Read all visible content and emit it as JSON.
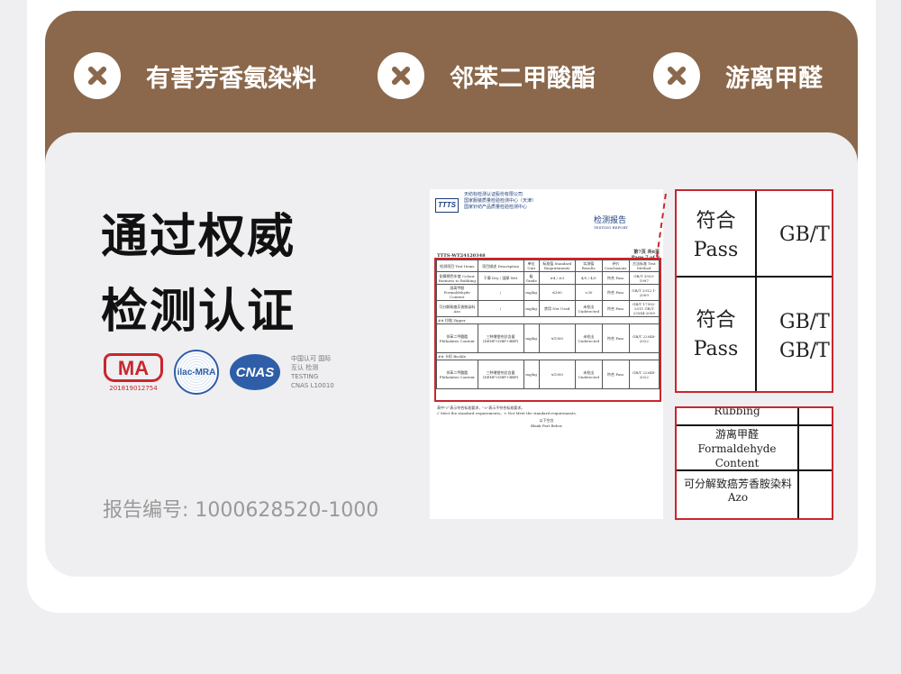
{
  "features": [
    {
      "icon": "x-circle-icon",
      "label": "有害芳香氨染料"
    },
    {
      "icon": "x-circle-icon",
      "label": "邻苯二甲酸酯"
    },
    {
      "icon": "x-circle-icon",
      "label": "游离甲醛"
    }
  ],
  "headline": {
    "line1": "通过权威",
    "line2": "检测认证"
  },
  "logos": {
    "ma": "MA",
    "ma_number": "201819012754",
    "ilac": "ilac-MRA",
    "cnas": "CNAS",
    "cnas_text": "中国认可 国际互认 检测",
    "cnas_testing": "TESTING",
    "cnas_no": "CNAS L10010"
  },
  "report_number": "报告编号: 1000628520-1000",
  "document": {
    "org_name": "天纺标检测认证股份有限公司",
    "org_sub": "国家服装质量检验检测中心（天津）",
    "org_sub2": "国家针纺产品质量检验检测中心",
    "logo": "TTTS",
    "title": "检测报告",
    "title_en": "TESTING REPORT",
    "report_no": "TTTS-WT24120348",
    "page": "第7页 共8页",
    "page_en": "Page 7 of 8",
    "headers": [
      "检测项目 Test Items",
      "项目描述 Description",
      "单位 Unit",
      "标准值 Standard Requirements",
      "实测值 Results",
      "评价 Conclusions",
      "方法标准 Test Method"
    ],
    "rows": [
      [
        "耐摩擦色牢度 Colour Fastness to Rubbing",
        "干摩 Dry / 湿摩 Wet",
        "级 Grade",
        "≥4 / ≥3",
        "4/5 / 4/5",
        "符合 Pass",
        "GB/T 3920-1997"
      ],
      [
        "游离甲醛 Formaldehyde Content",
        "/",
        "mg/kg",
        "≤300",
        "<30",
        "符合 Pass",
        "GB/T 2912.1-2009"
      ],
      [
        "可分解致癌芳香胺染料 Azo",
        "/",
        "mg/kg",
        "禁用 Not Used",
        "未检出 Undetected",
        "符合 Pass",
        "GB/T 17592-2011 GB/T 23344-2009"
      ]
    ],
    "section_zipper": "##    拉链 Zipper",
    "section_buckle": "##    卡扣 Buckle",
    "phthalate_row": [
      "邻苯二甲酸酯 Phthalates Content",
      "三种增塑剂总含量 (DEHP+DBP+BBP)",
      "mg/kg",
      "≤1000",
      "未检出 Undetected",
      "符合 Pass",
      "GB/T 22048-2022"
    ],
    "footnote1": "表中\"√\"表示符合标准要求，\"×\"表示不符合标准要求。",
    "footnote2": "√ Meet the standard requirements，× Not Meet the standard requirements.",
    "blank": "以下空白",
    "blank_en": "Blank Part Below"
  },
  "callout1": {
    "r1_conc": "符合",
    "r1_pass": "Pass",
    "r1_method": "GB/T",
    "r2_conc": "符合",
    "r2_pass": "Pass",
    "r2_method1": "GB/T",
    "r2_method2": "GB/T"
  },
  "callout2": {
    "rubbing": "Rubbing",
    "formaldehyde_cn": "游离甲醛",
    "formaldehyde_en": "Formaldehyde",
    "content": "Content",
    "azo_cn": "可分解致癌芳香胺染料",
    "azo_en": "Azo"
  }
}
